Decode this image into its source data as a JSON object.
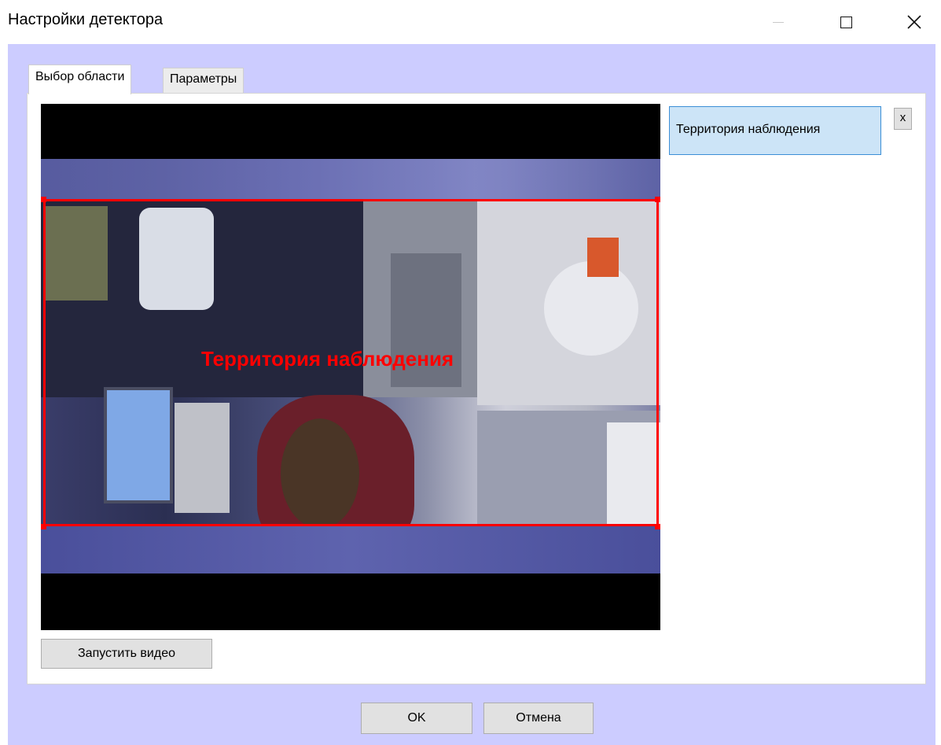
{
  "window": {
    "title": "Настройки детектора"
  },
  "titlebar_buttons": {
    "minimize_icon": "minimize-icon",
    "maximize_icon": "maximize-icon",
    "close_icon": "close-icon"
  },
  "tabs": [
    {
      "label": "Выбор области",
      "active": true
    },
    {
      "label": "Параметры",
      "active": false
    }
  ],
  "video": {
    "roi_label": "Территория наблюдения",
    "roi_color": "#ff0000"
  },
  "zones": {
    "items": [
      {
        "label": "Территория наблюдения",
        "selected": true
      }
    ],
    "remove_label": "x"
  },
  "buttons": {
    "run_video": "Запустить видео",
    "ok": "OK",
    "cancel": "Отмена"
  },
  "colors": {
    "client_background": "#ccccff",
    "selection_fill": "#cce4f7",
    "selection_border": "#3c8fd6"
  }
}
